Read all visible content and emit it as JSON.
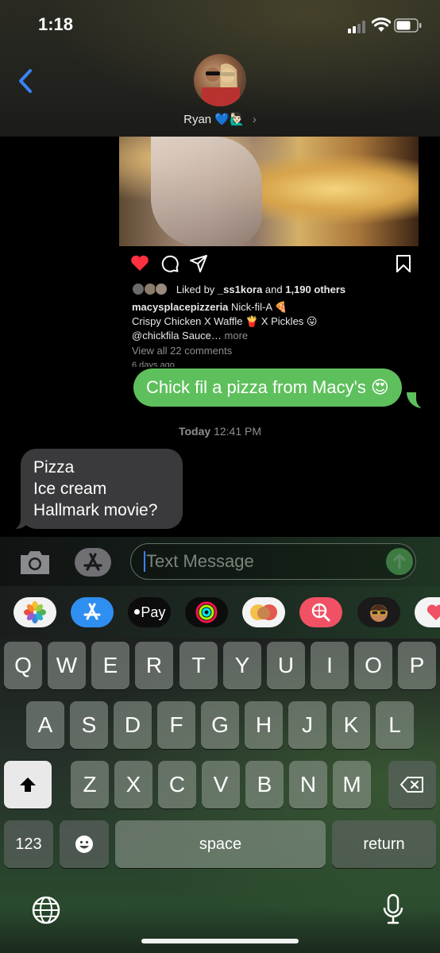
{
  "status_bar": {
    "time": "1:18"
  },
  "header": {
    "contact_name": "Ryan",
    "contact_emoji": "💙🙋🏻‍♂️",
    "chevron": "›"
  },
  "shared_post": {
    "liked_prefix": "Liked by ",
    "liked_user": "_ss1kora",
    "liked_and": " and ",
    "liked_count": "1,190 others",
    "caption_user": "macysplacepizzeria",
    "caption_line1": " Nick-fil-A 🍕",
    "caption_line2": "Crispy Chicken X Waffle 🍟 X Pickles 😛",
    "caption_line3": "@chickfila Sauce…",
    "caption_more": " more",
    "view_comments": "View all 22 comments",
    "date": "6 days ago"
  },
  "messages": {
    "sent": "Chick fil a pizza from Macy's 😍",
    "timestamp_day": "Today",
    "timestamp_time": " 12:41 PM",
    "received_lines": [
      "Pizza",
      "Ice cream",
      "Hallmark movie?"
    ]
  },
  "composer": {
    "placeholder": "Text Message"
  },
  "app_strip": {
    "apple_pay_label": "Pay",
    "apps": [
      "photos-app",
      "app-store",
      "apple-pay",
      "activity",
      "memoji-stickers",
      "web-images",
      "memoji",
      "digital-touch"
    ]
  },
  "keyboard": {
    "row1": [
      "Q",
      "W",
      "E",
      "R",
      "T",
      "Y",
      "U",
      "I",
      "O",
      "P"
    ],
    "row2": [
      "A",
      "S",
      "D",
      "F",
      "G",
      "H",
      "J",
      "K",
      "L"
    ],
    "row3": [
      "Z",
      "X",
      "C",
      "V",
      "B",
      "N",
      "M"
    ],
    "numbers_label": "123",
    "space_label": "space",
    "return_label": "return"
  },
  "colors": {
    "sent_bubble": "#5ec05c",
    "received_bubble": "#3a3a3c",
    "accent_blue": "#3b82f6",
    "like_red": "#ff3040"
  }
}
